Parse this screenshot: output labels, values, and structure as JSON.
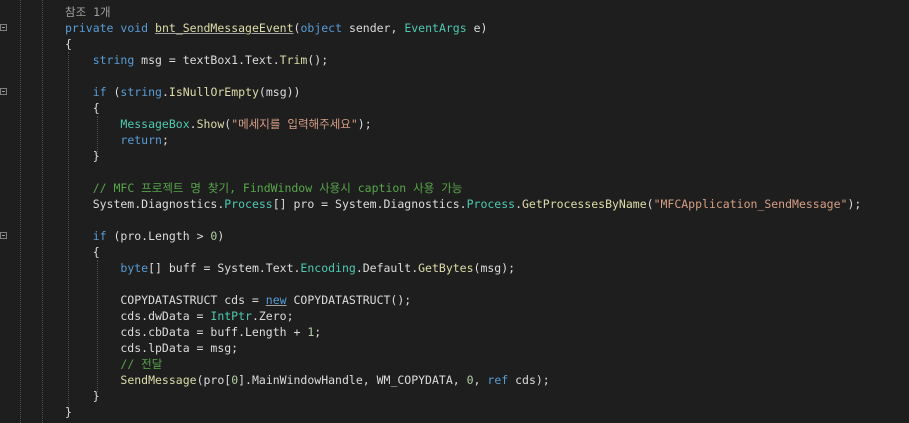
{
  "editor": {
    "lines": [
      {
        "fold": false,
        "tokens": [
          {
            "t": "ref",
            "v": "참조 1개"
          }
        ]
      },
      {
        "fold": true,
        "tokens": [
          {
            "t": "kw",
            "v": "private"
          },
          {
            "t": "text",
            "v": " "
          },
          {
            "t": "kw",
            "v": "void"
          },
          {
            "t": "text",
            "v": " "
          },
          {
            "t": "fn",
            "v": "bnt_SendMessageEvent",
            "u": true
          },
          {
            "t": "text",
            "v": "("
          },
          {
            "t": "kw",
            "v": "object"
          },
          {
            "t": "text",
            "v": " sender, "
          },
          {
            "t": "type",
            "v": "EventArgs"
          },
          {
            "t": "text",
            "v": " e)"
          }
        ]
      },
      {
        "fold": false,
        "tokens": [
          {
            "t": "text",
            "v": "{"
          }
        ]
      },
      {
        "fold": false,
        "tokens": [
          {
            "t": "text",
            "v": "    "
          },
          {
            "t": "kw",
            "v": "string"
          },
          {
            "t": "text",
            "v": " msg = textBox1.Text."
          },
          {
            "t": "fn",
            "v": "Trim"
          },
          {
            "t": "text",
            "v": "();"
          }
        ]
      },
      {
        "fold": false,
        "tokens": []
      },
      {
        "fold": true,
        "tokens": [
          {
            "t": "text",
            "v": "    "
          },
          {
            "t": "kw",
            "v": "if"
          },
          {
            "t": "text",
            "v": " ("
          },
          {
            "t": "kw",
            "v": "string"
          },
          {
            "t": "text",
            "v": "."
          },
          {
            "t": "fn",
            "v": "IsNullOrEmpty"
          },
          {
            "t": "text",
            "v": "(msg))"
          }
        ]
      },
      {
        "fold": false,
        "tokens": [
          {
            "t": "text",
            "v": "    {"
          }
        ]
      },
      {
        "fold": false,
        "tokens": [
          {
            "t": "text",
            "v": "        "
          },
          {
            "t": "type",
            "v": "MessageBox"
          },
          {
            "t": "text",
            "v": "."
          },
          {
            "t": "fn",
            "v": "Show"
          },
          {
            "t": "text",
            "v": "("
          },
          {
            "t": "str",
            "v": "\"메세지를 입력해주세요\""
          },
          {
            "t": "text",
            "v": ");"
          }
        ]
      },
      {
        "fold": false,
        "tokens": [
          {
            "t": "text",
            "v": "        "
          },
          {
            "t": "kw",
            "v": "return"
          },
          {
            "t": "text",
            "v": ";"
          }
        ]
      },
      {
        "fold": false,
        "tokens": [
          {
            "t": "text",
            "v": "    }"
          }
        ]
      },
      {
        "fold": false,
        "tokens": []
      },
      {
        "fold": false,
        "tokens": [
          {
            "t": "text",
            "v": "    "
          },
          {
            "t": "cm",
            "v": "// MFC 프로젝트 명 찾기, FindWindow 사용시 caption 사용 가능"
          }
        ]
      },
      {
        "fold": false,
        "tokens": [
          {
            "t": "text",
            "v": "    System.Diagnostics."
          },
          {
            "t": "type",
            "v": "Process"
          },
          {
            "t": "text",
            "v": "[] pro = System.Diagnostics."
          },
          {
            "t": "type",
            "v": "Process"
          },
          {
            "t": "text",
            "v": "."
          },
          {
            "t": "fn",
            "v": "GetProcessesByName"
          },
          {
            "t": "text",
            "v": "("
          },
          {
            "t": "str",
            "v": "\"MFCApplication_SendMessage\""
          },
          {
            "t": "text",
            "v": ");"
          }
        ]
      },
      {
        "fold": false,
        "tokens": []
      },
      {
        "fold": true,
        "tokens": [
          {
            "t": "text",
            "v": "    "
          },
          {
            "t": "kw",
            "v": "if"
          },
          {
            "t": "text",
            "v": " (pro.Length > "
          },
          {
            "t": "num",
            "v": "0"
          },
          {
            "t": "text",
            "v": ")"
          }
        ]
      },
      {
        "fold": false,
        "tokens": [
          {
            "t": "text",
            "v": "    {"
          }
        ]
      },
      {
        "fold": false,
        "tokens": [
          {
            "t": "text",
            "v": "        "
          },
          {
            "t": "kw",
            "v": "byte"
          },
          {
            "t": "text",
            "v": "[] buff = System.Text."
          },
          {
            "t": "type",
            "v": "Encoding"
          },
          {
            "t": "text",
            "v": ".Default."
          },
          {
            "t": "fn",
            "v": "GetBytes"
          },
          {
            "t": "text",
            "v": "(msg);"
          }
        ]
      },
      {
        "fold": false,
        "tokens": []
      },
      {
        "fold": false,
        "tokens": [
          {
            "t": "text",
            "v": "        COPYDATASTRUCT cds = "
          },
          {
            "t": "kw",
            "v": "new",
            "u": true
          },
          {
            "t": "text",
            "v": " COPYDATASTRUCT();"
          }
        ]
      },
      {
        "fold": false,
        "tokens": [
          {
            "t": "text",
            "v": "        cds.dwData = "
          },
          {
            "t": "type",
            "v": "IntPtr"
          },
          {
            "t": "text",
            "v": ".Zero;"
          }
        ]
      },
      {
        "fold": false,
        "tokens": [
          {
            "t": "text",
            "v": "        cds.cbData = buff.Length + "
          },
          {
            "t": "num",
            "v": "1"
          },
          {
            "t": "text",
            "v": ";"
          }
        ]
      },
      {
        "fold": false,
        "tokens": [
          {
            "t": "text",
            "v": "        cds.lpData = msg;"
          }
        ]
      },
      {
        "fold": false,
        "tokens": [
          {
            "t": "text",
            "v": "        "
          },
          {
            "t": "cm",
            "v": "// 전달"
          }
        ]
      },
      {
        "fold": false,
        "tokens": [
          {
            "t": "text",
            "v": "        "
          },
          {
            "t": "fn",
            "v": "SendMessage"
          },
          {
            "t": "text",
            "v": "(pro["
          },
          {
            "t": "num",
            "v": "0"
          },
          {
            "t": "text",
            "v": "].MainWindowHandle, WM_COPYDATA, "
          },
          {
            "t": "num",
            "v": "0"
          },
          {
            "t": "text",
            "v": ", "
          },
          {
            "t": "kw",
            "v": "ref"
          },
          {
            "t": "text",
            "v": " cds);"
          }
        ]
      },
      {
        "fold": false,
        "tokens": [
          {
            "t": "text",
            "v": "    }"
          }
        ]
      },
      {
        "fold": false,
        "tokens": [
          {
            "t": "text",
            "v": "}"
          }
        ]
      }
    ]
  }
}
